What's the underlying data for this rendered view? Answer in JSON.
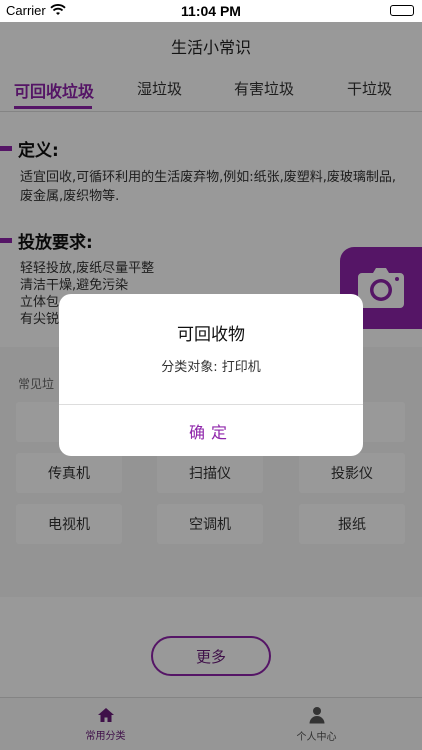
{
  "status_bar": {
    "carrier": "Carrier",
    "time": "11:04 PM"
  },
  "nav": {
    "title": "生活小常识"
  },
  "tabs": [
    {
      "label": "可回收垃圾",
      "active": true
    },
    {
      "label": "湿垃圾",
      "active": false
    },
    {
      "label": "有害垃圾",
      "active": false
    },
    {
      "label": "干垃圾",
      "active": false
    }
  ],
  "definition": {
    "heading": "定义:",
    "text": "适宜回收,可循环利用的生活废弃物,例如:纸张,废塑料,废玻璃制品,废金属,废织物等."
  },
  "requirements": {
    "heading": "投放要求:",
    "lines": [
      "轻轻投放,废纸尽量平整",
      "清洁干燥,避免污染",
      "立体包",
      "有尖锐"
    ]
  },
  "camera": {
    "icon": "camera-icon"
  },
  "common": {
    "label": "常见垃",
    "items": [
      [
        "电",
        "",
        "机"
      ],
      [
        "传真机",
        "扫描仪",
        "投影仪"
      ],
      [
        "电视机",
        "空调机",
        "报纸"
      ]
    ]
  },
  "more_button": {
    "label": "更多"
  },
  "tab_bar": [
    {
      "label": "常用分类",
      "icon": "home-icon",
      "active": true
    },
    {
      "label": "个人中心",
      "icon": "person-icon",
      "active": false
    }
  ],
  "dialog": {
    "title": "可回收物",
    "message": "分类对象: 打印机",
    "confirm": "确定"
  },
  "colors": {
    "accent": "#8e24aa",
    "overlay": "rgba(0,0,0,0.40)"
  }
}
